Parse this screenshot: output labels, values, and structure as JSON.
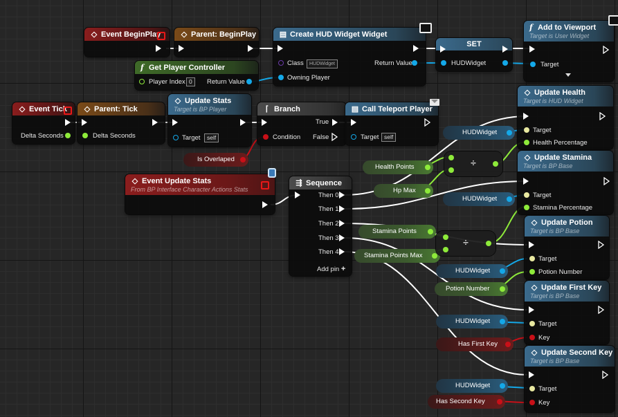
{
  "nodes": {
    "begin_play": {
      "title": "Event BeginPlay"
    },
    "parent_begin_play": {
      "title": "Parent: BeginPlay"
    },
    "create_widget": {
      "title": "Create HUD Widget Widget",
      "class_label": "Class",
      "class_value": "HUDWidget",
      "owning_player": "Owning Player",
      "return_value": "Return Value"
    },
    "set_node": {
      "title": "SET",
      "pin": "HUDWidget"
    },
    "add_to_viewport": {
      "title": "Add to Viewport",
      "subtitle": "Target is User Widget",
      "target": "Target"
    },
    "get_player_controller": {
      "title": "Get Player Controller",
      "player_index": "Player Index",
      "player_index_value": "0",
      "return_value": "Return Value"
    },
    "event_tick": {
      "title": "Event Tick",
      "delta": "Delta Seconds"
    },
    "parent_tick": {
      "title": "Parent: Tick",
      "delta": "Delta Seconds"
    },
    "update_stats": {
      "title": "Update Stats",
      "subtitle": "Target is BP Player",
      "target": "Target",
      "self": "self"
    },
    "branch": {
      "title": "Branch",
      "condition": "Condition",
      "true": "True",
      "false": "False"
    },
    "call_teleport": {
      "title": "Call Teleport Player",
      "target": "Target",
      "self": "self"
    },
    "is_overlapped": {
      "label": "Is Overlaped"
    },
    "event_update_stats": {
      "title": "Event Update Stats",
      "subtitle": "From BP Interface Character Actions Stats"
    },
    "sequence": {
      "title": "Sequence",
      "then0": "Then 0",
      "then1": "Then 1",
      "then2": "Then 2",
      "then3": "Then 3",
      "then4": "Then 4",
      "add_pin": "Add pin"
    },
    "update_health": {
      "title": "Update Health",
      "subtitle": "Target is HUD Widget",
      "target": "Target",
      "param": "Health Percentage"
    },
    "update_stamina": {
      "title": "Update Stamina",
      "subtitle": "Target is BP Base",
      "target": "Target",
      "param": "Stamina Percentage"
    },
    "update_potion": {
      "title": "Update Potion",
      "subtitle": "Target is BP Base",
      "target": "Target",
      "param": "Potion Number"
    },
    "update_first_key": {
      "title": "Update First Key",
      "subtitle": "Target is BP Base",
      "target": "Target",
      "param": "Key"
    },
    "update_second_key": {
      "title": "Update Second Key",
      "subtitle": "Target is BP Base",
      "target": "Target",
      "param": "Key"
    }
  },
  "variables": {
    "hudwidget": "HUDWidget",
    "health_points": "Health Points",
    "hp_max": "Hp Max",
    "stamina_points": "Stamina Points",
    "stamina_points_max": "Stamina Points Max",
    "potion_number": "Potion Number",
    "has_first_key": "Has First Key",
    "has_second_key": "Has Second Key"
  },
  "operators": {
    "divide": "÷"
  },
  "icons": {
    "event": "diamond-event-icon",
    "function": "f-function-icon",
    "branch": "branch-icon",
    "sequence": "sequence-icon",
    "widget": "widget-icon",
    "message": "envelope-icon",
    "monitor": "monitor-icon",
    "player": "player-icon"
  },
  "colors": {
    "background": "#262626",
    "exec_wire": "#ffffff",
    "float_pin": "#8eea3a",
    "object_pin": "#14a8e8",
    "bool_pin": "#c81018",
    "event_header": "#8a1d1d",
    "function_header": "#3b6a8c",
    "pure_header": "#3f6a28",
    "parent_header": "#7a4a18"
  }
}
